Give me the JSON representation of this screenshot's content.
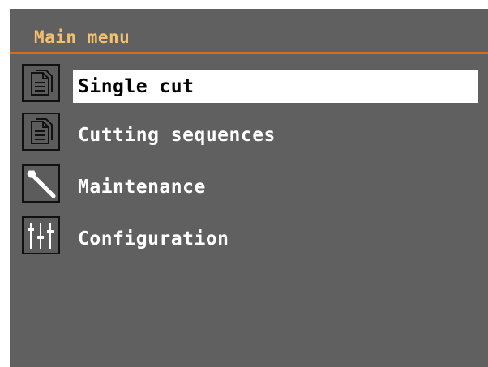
{
  "header": {
    "title": "Main menu"
  },
  "menu": {
    "items": [
      {
        "label": "Single cut",
        "icon": "document-icon",
        "selected": true
      },
      {
        "label": "Cutting sequences",
        "icon": "document-icon",
        "selected": false
      },
      {
        "label": "Maintenance",
        "icon": "wrench-icon",
        "selected": false
      },
      {
        "label": "Configuration",
        "icon": "sliders-icon",
        "selected": false
      }
    ]
  },
  "colors": {
    "background": "#606060",
    "title": "#f4c06e",
    "accent_rule": "#e06a1a",
    "selection": "#ffffff"
  }
}
